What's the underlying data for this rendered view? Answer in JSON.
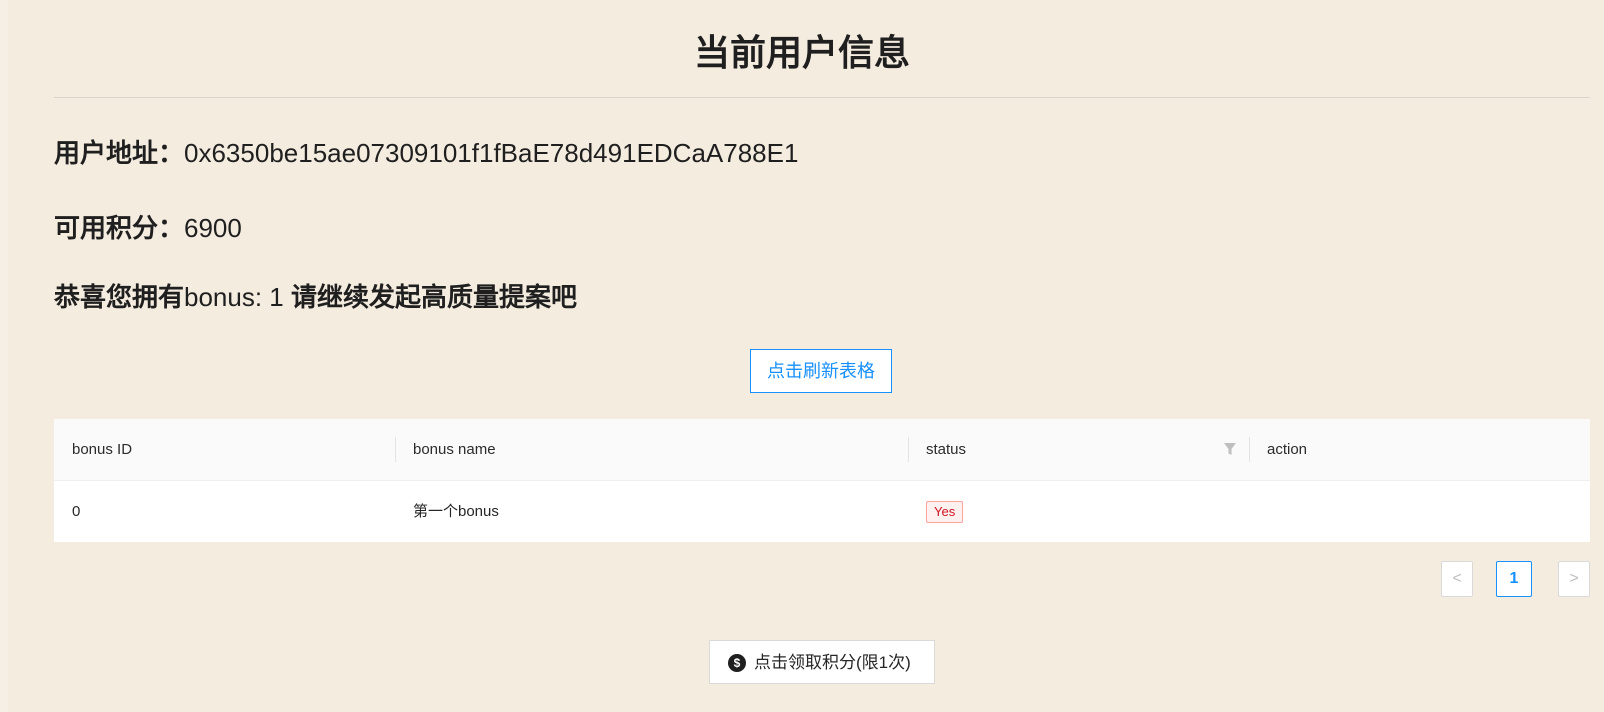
{
  "page": {
    "title": "当前用户信息"
  },
  "user": {
    "address_label": "用户地址：",
    "address_value": "0x6350be15ae07309101f1fBaE78d491EDCaA788E1",
    "points_label": "可用积分：",
    "points_value": "6900",
    "bonus_prefix": "恭喜您拥有",
    "bonus_text": "bonus: 1",
    "bonus_suffix": " 请继续发起高质量提案吧"
  },
  "toolbar": {
    "refresh_label": "点击刷新表格"
  },
  "table": {
    "columns": [
      "bonus ID",
      "bonus name",
      "status",
      "action"
    ],
    "rows": [
      {
        "id": "0",
        "name": "第一个bonus",
        "status": "Yes",
        "action": ""
      }
    ]
  },
  "pagination": {
    "prev_symbol": "<",
    "current_page": "1",
    "next_symbol": ">"
  },
  "claim": {
    "icon_glyph": "$",
    "label": "点击领取积分(限1次)"
  },
  "colors": {
    "background": "#f5ece0",
    "accent": "#1890ff",
    "status_red": "#cf1322"
  },
  "icons": {
    "filter": "filter-icon",
    "claim": "dollar-circle-icon"
  }
}
